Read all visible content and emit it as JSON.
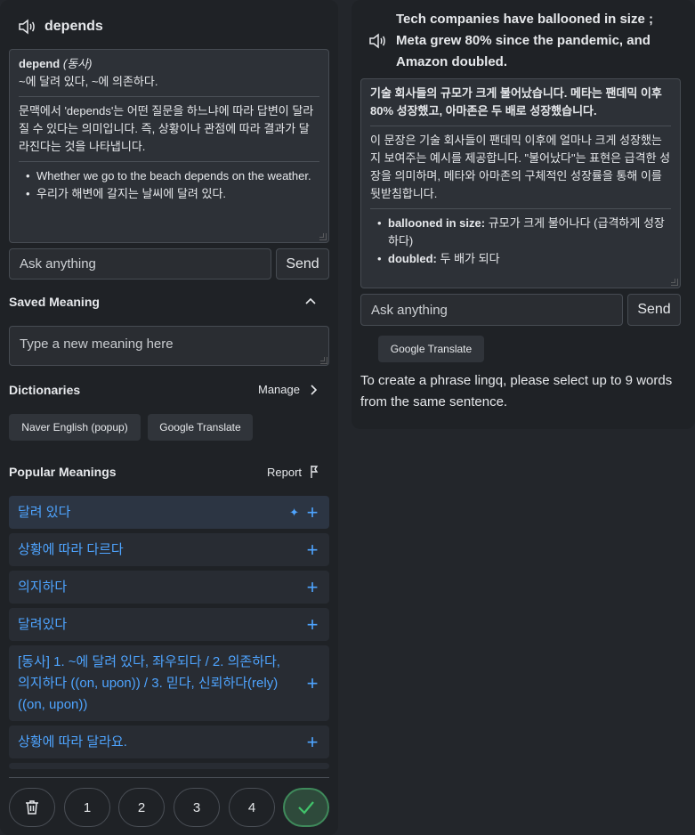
{
  "left": {
    "word": "depends",
    "ai": {
      "headword": "depend",
      "pos": "(동사)",
      "meaning": "~에 달려 있다, ~에 의존하다.",
      "explanation": "문맥에서 'depends'는 어떤 질문을 하느냐에 따라 답변이 달라질 수 있다는 의미입니다. 즉, 상황이나 관점에 따라 결과가 달라진다는 것을 나타냅니다.",
      "examples": [
        "Whether we go to the beach depends on the weather.",
        "우리가 해변에 갈지는 날씨에 달려 있다."
      ]
    },
    "ask_placeholder": "Ask anything",
    "send_label": "Send",
    "saved_meaning": {
      "title": "Saved Meaning",
      "placeholder": "Type a new meaning here"
    },
    "dictionaries": {
      "title": "Dictionaries",
      "manage_label": "Manage",
      "items": [
        "Naver English (popup)",
        "Google Translate"
      ]
    },
    "popular": {
      "title": "Popular Meanings",
      "report_label": "Report",
      "items": [
        "달려 있다",
        "상황에 따라 다르다",
        "의지하다",
        "달려있다",
        "[동사] 1. ~에 달려 있다, 좌우되다 / 2. 의존하다, 의지하다 ((on, upon)) / 3. 믿다, 신뢰하다(rely) ((on, upon))",
        "상황에 따라 달라요."
      ]
    },
    "status_buttons": [
      "1",
      "2",
      "3",
      "4"
    ],
    "colors": {
      "accent": "#4ea4ff",
      "known": "#41c46b"
    }
  },
  "right": {
    "phrase": "Tech companies have ballooned in size ; Meta grew 80% since the pandemic, and Amazon doubled.",
    "ai": {
      "translation": "기술 회사들의 규모가 크게 불어났습니다. 메타는 팬데믹 이후 80% 성장했고, 아마존은 두 배로 성장했습니다.",
      "explanation": "이 문장은 기술 회사들이 팬데믹 이후에 얼마나 크게 성장했는지 보여주는 예시를 제공합니다. \"불어났다\"는 표현은 급격한 성장을 의미하며, 메타와 아마존의 구체적인 성장률을 통해 이를 뒷받침합니다.",
      "vocab": [
        {
          "term": "ballooned in size:",
          "def": "규모가 크게 불어나다 (급격하게 성장하다)"
        },
        {
          "term": "doubled:",
          "def": "두 배가 되다"
        }
      ]
    },
    "ask_placeholder": "Ask anything",
    "send_label": "Send",
    "google_translate_label": "Google Translate",
    "info": "To create a phrase lingq, please select up to 9 words from the same sentence."
  }
}
